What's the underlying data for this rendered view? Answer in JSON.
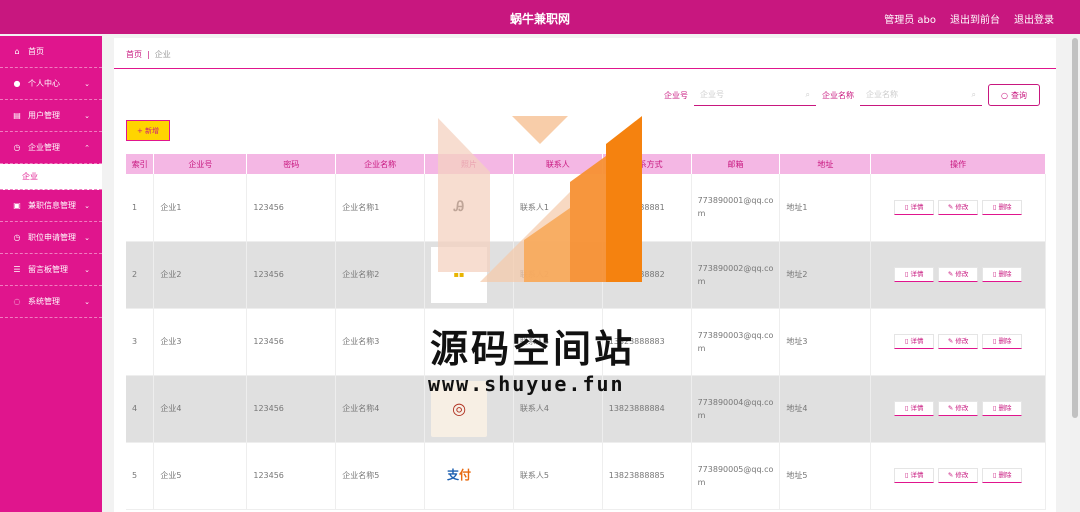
{
  "header": {
    "app_title": "蜗牛兼职网",
    "admin_label": "管理员 abo",
    "exit_front_label": "退出到前台",
    "logout_label": "退出登录"
  },
  "sidebar": {
    "items": [
      {
        "label": "首页",
        "icon": "home-icon",
        "chevron": false
      },
      {
        "label": "个人中心",
        "icon": "user-icon",
        "chevron": true
      },
      {
        "label": "用户管理",
        "icon": "list-icon",
        "chevron": true
      },
      {
        "label": "企业管理",
        "icon": "clock-icon",
        "chevron": true,
        "expanded": true
      },
      {
        "label": "兼职信息管理",
        "icon": "document-icon",
        "chevron": true
      },
      {
        "label": "职位申请管理",
        "icon": "clock-icon",
        "chevron": true
      },
      {
        "label": "留言板管理",
        "icon": "menu-icon",
        "chevron": true
      },
      {
        "label": "系统管理",
        "icon": "gear-icon",
        "chevron": true
      }
    ],
    "submenu_active": "企业"
  },
  "breadcrumb": {
    "home": "首页",
    "separator": "|",
    "current": "企业"
  },
  "search": {
    "field1_label": "企业号",
    "field1_placeholder": "企业号",
    "field2_label": "企业名称",
    "field2_placeholder": "企业名称",
    "button_label": "查询"
  },
  "add_button_label": "+ 新增",
  "table": {
    "columns": [
      "索引",
      "企业号",
      "密码",
      "企业名称",
      "照片",
      "联系人",
      "联系方式",
      "邮箱",
      "地址",
      "操作"
    ],
    "rows": [
      {
        "index": "1",
        "company_no": "企业1",
        "password": "123456",
        "company_name": "企业名称1",
        "contact": "联系人1",
        "phone": "13823888881",
        "email": "773890001@qq.com",
        "address": "地址1"
      },
      {
        "index": "2",
        "company_no": "企业2",
        "password": "123456",
        "company_name": "企业名称2",
        "contact": "联系人2",
        "phone": "13823888882",
        "email": "773890002@qq.com",
        "address": "地址2"
      },
      {
        "index": "3",
        "company_no": "企业3",
        "password": "123456",
        "company_name": "企业名称3",
        "contact": "联系人3",
        "phone": "13823888883",
        "email": "773890003@qq.com",
        "address": "地址3"
      },
      {
        "index": "4",
        "company_no": "企业4",
        "password": "123456",
        "company_name": "企业名称4",
        "contact": "联系人4",
        "phone": "13823888884",
        "email": "773890004@qq.com",
        "address": "地址4"
      },
      {
        "index": "5",
        "company_no": "企业5",
        "password": "123456",
        "company_name": "企业名称5",
        "contact": "联系人5",
        "phone": "13823888885",
        "email": "773890005@qq.com",
        "address": "地址5"
      }
    ],
    "ops": {
      "detail": "详情",
      "edit": "修改",
      "delete": "删除"
    }
  },
  "watermark": {
    "text": "源码空间站",
    "url": "www.shuyue.fun"
  },
  "colors": {
    "primary": "#c8177f",
    "sidebar": "#e0158d",
    "header_row": "#f4b7e4",
    "add_button": "#ffd400"
  }
}
